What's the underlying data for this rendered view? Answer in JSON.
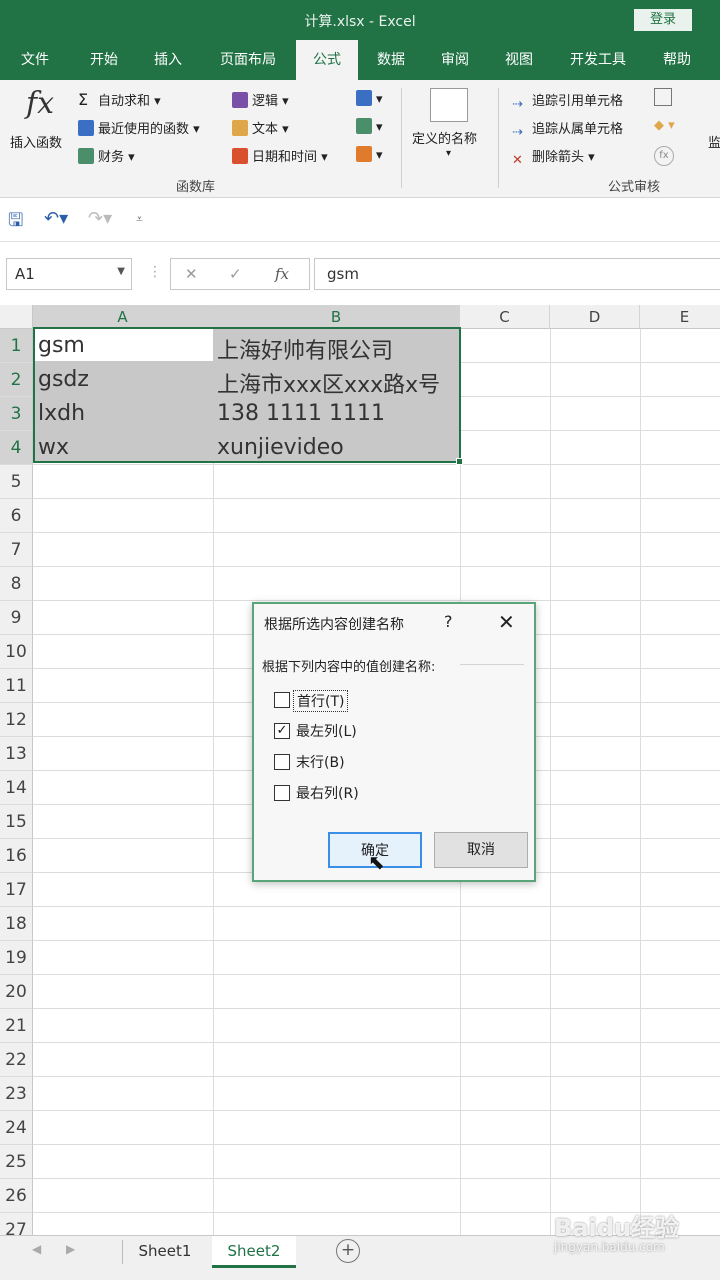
{
  "window": {
    "title": "计算.xlsx  -  Excel",
    "login_label": "登录"
  },
  "tabs": [
    {
      "label": "文件"
    },
    {
      "label": "开始"
    },
    {
      "label": "插入"
    },
    {
      "label": "页面布局"
    },
    {
      "label": "公式",
      "active": true
    },
    {
      "label": "数据"
    },
    {
      "label": "审阅"
    },
    {
      "label": "视图"
    },
    {
      "label": "开发工具"
    },
    {
      "label": "帮助"
    }
  ],
  "ribbon": {
    "insert_function": "插入函数",
    "autosum": "自动求和",
    "recent": "最近使用的函数",
    "financial": "财务",
    "logical": "逻辑",
    "text": "文本",
    "datetime": "日期和时间",
    "function_library_label": "函数库",
    "defined_names": "定义的名称",
    "trace_precedents": "追踪引用单元格",
    "trace_dependents": "追踪从属单元格",
    "remove_arrows": "删除箭头",
    "formula_auditing_label": "公式审核",
    "cut_off": "监"
  },
  "formula_bar": {
    "name_box": "A1",
    "formula": "gsm",
    "fx": "fx"
  },
  "grid": {
    "columns": [
      "A",
      "B",
      "C",
      "D",
      "E"
    ],
    "rows": [
      "1",
      "2",
      "3",
      "4",
      "5",
      "6",
      "7",
      "8",
      "9",
      "10",
      "11",
      "12",
      "13",
      "14",
      "15",
      "16",
      "17",
      "18",
      "19",
      "20",
      "21",
      "22",
      "23",
      "24",
      "25",
      "26",
      "27"
    ],
    "cells": {
      "A1": "gsm",
      "B1": "上海好帅有限公司",
      "A2": "gsdz",
      "B2": "上海市xxx区xxx路x号",
      "A3": "lxdh",
      "B3": "138  1111  1111",
      "A4": "wx",
      "B4": "xunjievideo"
    }
  },
  "dialog": {
    "title": "根据所选内容创建名称",
    "help": "?",
    "close": "✕",
    "prompt": "根据下列内容中的值创建名称:",
    "options": [
      {
        "label": "首行(T)",
        "checked": false
      },
      {
        "label": "最左列(L)",
        "checked": true
      },
      {
        "label": "末行(B)",
        "checked": false
      },
      {
        "label": "最右列(R)",
        "checked": false
      }
    ],
    "ok": "确定",
    "cancel": "取消"
  },
  "sheets": [
    {
      "label": "Sheet1"
    },
    {
      "label": "Sheet2",
      "active": true
    }
  ],
  "add_sheet": "+",
  "watermark": {
    "text": "Baidu经验",
    "sub": "jingyan.baidu.com"
  },
  "colors": {
    "excel_green": "#217346",
    "selection": "#c8c8c8"
  }
}
